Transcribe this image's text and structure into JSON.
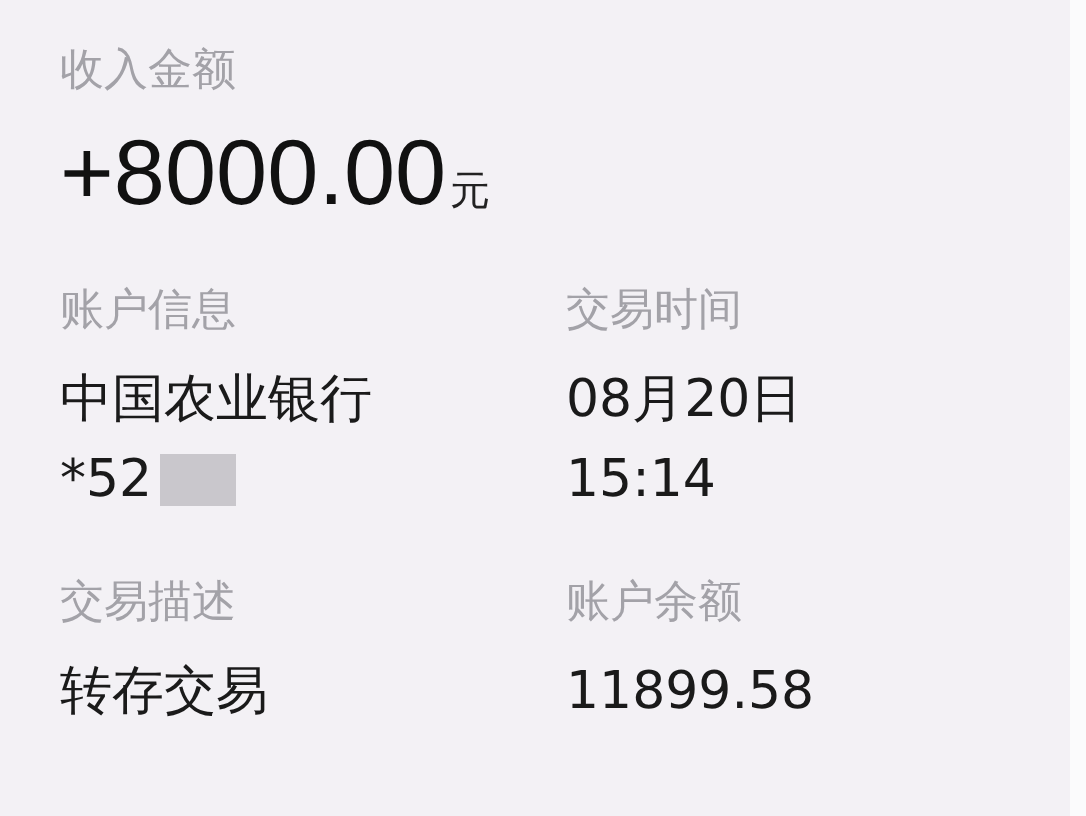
{
  "income": {
    "label": "收入金额",
    "amount": "+8000.00",
    "unit": "元"
  },
  "details": [
    {
      "label": "账户信息",
      "lines": [
        "中国农业银行",
        "*52"
      ],
      "masked": true
    },
    {
      "label": "交易时间",
      "lines": [
        "08月20日",
        "15:14"
      ],
      "masked": false
    },
    {
      "label": "交易描述",
      "lines": [
        "转存交易"
      ],
      "masked": false
    },
    {
      "label": "账户余额",
      "lines": [
        "11899.58"
      ],
      "masked": false
    }
  ]
}
